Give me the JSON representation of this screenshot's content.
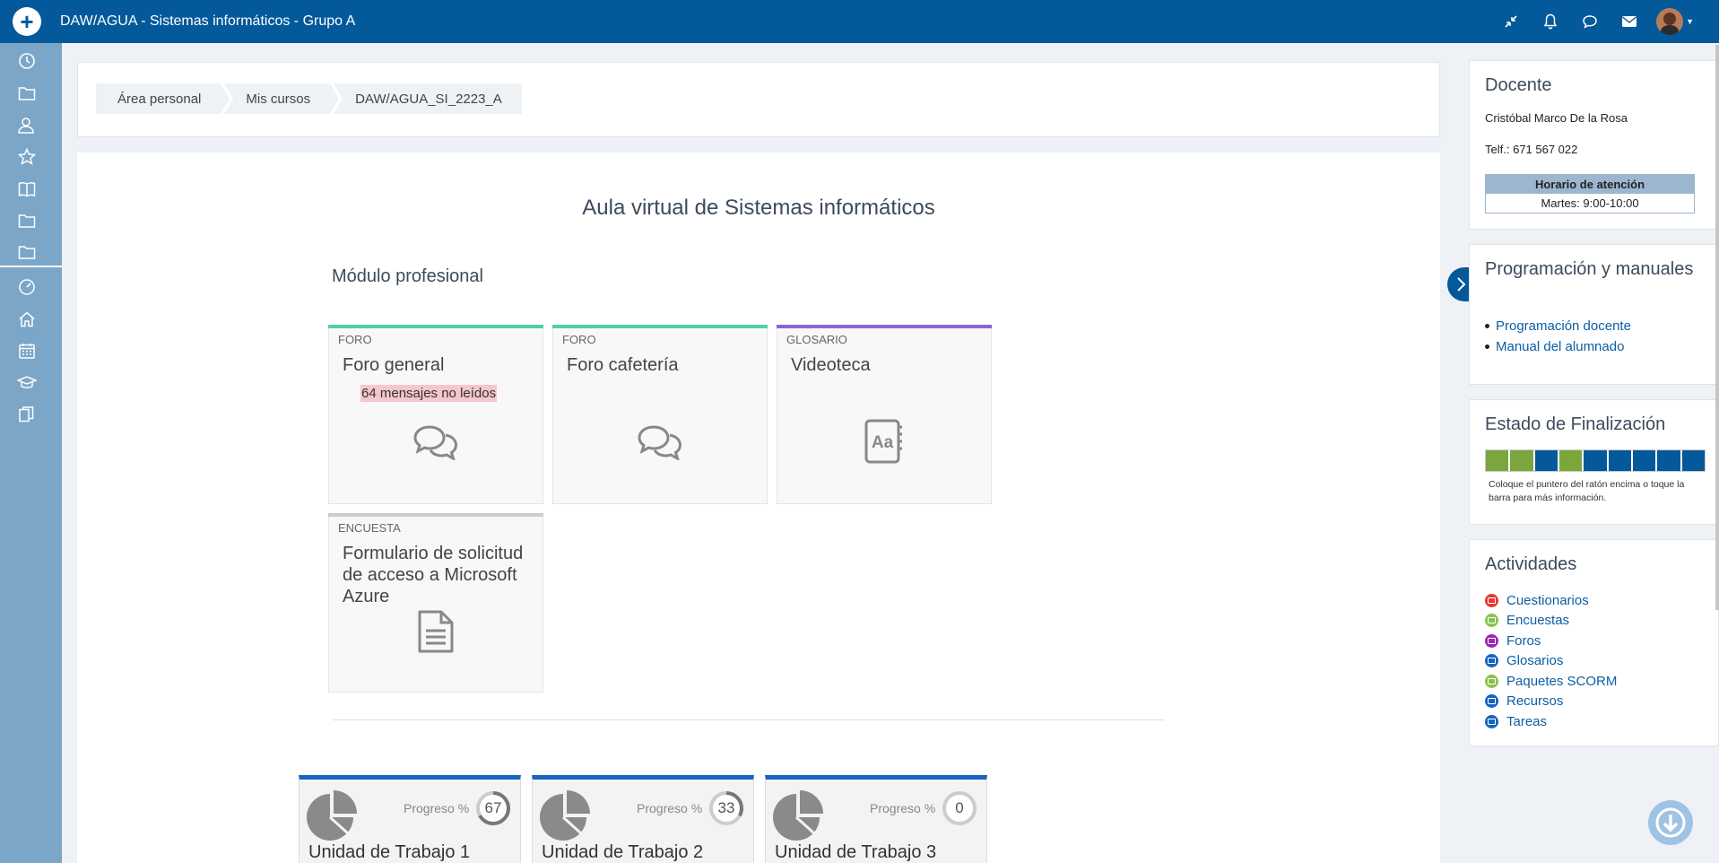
{
  "topbar": {
    "title": "DAW/AGUA - Sistemas informáticos - Grupo A",
    "add_icon": "plus-icon",
    "icons": [
      "compress-icon",
      "bell-icon",
      "chat-icon",
      "envelope-icon"
    ]
  },
  "sidebar": {
    "icons": [
      "clock-icon",
      "folder-icon",
      "users-icon",
      "star-icon",
      "book-icon",
      "folder-icon",
      "folder-icon",
      "dashboard-icon",
      "home-icon",
      "calendar-icon",
      "graduation-cap-icon",
      "copy-icon"
    ]
  },
  "breadcrumb": [
    "Área personal",
    "Mis cursos",
    "DAW/AGUA_SI_2223_A"
  ],
  "main": {
    "course_title": "Aula virtual de Sistemas informáticos",
    "section_title": "Módulo profesional",
    "tiles": [
      {
        "type": "FORO",
        "name": "Foro general",
        "unread": "64 mensajes no leídos",
        "icon": "comments-icon",
        "color": "#4fd1a0"
      },
      {
        "type": "FORO",
        "name": "Foro cafetería",
        "unread": "",
        "icon": "comments-icon",
        "color": "#4fd1a0"
      },
      {
        "type": "GLOSARIO",
        "name": "Videoteca",
        "unread": "",
        "icon": "glossary-icon",
        "color": "#8c64d8"
      },
      {
        "type": "ENCUESTA",
        "name": "Formulario de solicitud de acceso a Microsoft Azure",
        "unread": "",
        "icon": "document-icon",
        "color": "#cccccc"
      }
    ],
    "units": [
      {
        "progress_label": "Progreso %",
        "progress": "67",
        "name": "Unidad de Trabajo 1"
      },
      {
        "progress_label": "Progreso %",
        "progress": "33",
        "name": "Unidad de Trabajo 2"
      },
      {
        "progress_label": "Progreso %",
        "progress": "0",
        "name": "Unidad de Trabajo 3"
      }
    ]
  },
  "right": {
    "docente": {
      "title": "Docente",
      "name": "Cristóbal Marco De la Rosa",
      "phone": "Telf.: 671 567 022",
      "horario_title": "Horario de atención",
      "horario_value": "Martes: 9:00-10:00"
    },
    "programacion": {
      "title": "Programación y manuales",
      "links": [
        "Programación docente",
        "Manual del alumnado"
      ]
    },
    "estado": {
      "title": "Estado de Finalización",
      "segments": [
        "#7aa63c",
        "#7aa63c",
        "#03599a",
        "#7aa63c",
        "#03599a",
        "#03599a",
        "#03599a",
        "#03599a",
        "#03599a"
      ],
      "note": "Coloque el puntero del ratón encima o toque la barra para más información."
    },
    "actividades": {
      "title": "Actividades",
      "items": [
        {
          "label": "Cuestionarios",
          "color": "#e53935"
        },
        {
          "label": "Encuestas",
          "color": "#8bc34a"
        },
        {
          "label": "Foros",
          "color": "#9c27b0"
        },
        {
          "label": "Glosarios",
          "color": "#1565c0"
        },
        {
          "label": "Paquetes SCORM",
          "color": "#8bc34a"
        },
        {
          "label": "Recursos",
          "color": "#1565c0"
        },
        {
          "label": "Tareas",
          "color": "#1565c0"
        }
      ]
    }
  }
}
